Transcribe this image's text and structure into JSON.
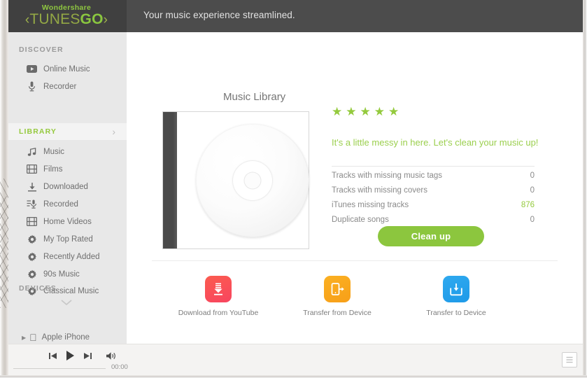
{
  "header": {
    "brand_top": "Wondershare",
    "brand_tunes": "TUNES",
    "brand_go": "GO",
    "paren_left": "‹",
    "paren_right": "›",
    "tagline": "Your music experience streamlined."
  },
  "sidebar": {
    "discover_title": "DISCOVER",
    "discover_items": [
      {
        "label": "Online Music",
        "icon": "youtube-icon"
      },
      {
        "label": "Recorder",
        "icon": "microphone-icon"
      }
    ],
    "library_title": "LIBRARY",
    "library_chevron": "›",
    "library_items": [
      {
        "label": "Music",
        "icon": "music-note-icon"
      },
      {
        "label": "Films",
        "icon": "film-icon"
      },
      {
        "label": "Downloaded",
        "icon": "download-icon"
      },
      {
        "label": "Recorded",
        "icon": "recorded-icon"
      },
      {
        "label": "Home Videos",
        "icon": "film-icon"
      },
      {
        "label": "My Top Rated",
        "icon": "gear-icon"
      },
      {
        "label": "Recently Added",
        "icon": "gear-icon"
      },
      {
        "label": "90s Music",
        "icon": "gear-icon"
      },
      {
        "label": "Classical Music",
        "icon": "gear-icon"
      }
    ],
    "expand_chevron": "⌄",
    "devices_title": "DEVICES",
    "devices_items": [
      {
        "label": "Apple iPhone",
        "icon": "apple-icon",
        "disclosure": "▶"
      }
    ]
  },
  "main": {
    "library_title": "Music Library",
    "rating_stars": 5,
    "star_glyph": "★",
    "messy_message": "It's a little messy in here. Let's clean your music up!",
    "stats": [
      {
        "label": "Tracks with missing music tags",
        "value": "0",
        "highlight": false
      },
      {
        "label": "Tracks with missing covers",
        "value": "0",
        "highlight": false
      },
      {
        "label": "iTunes missing tracks",
        "value": "876",
        "highlight": true
      },
      {
        "label": "Duplicate songs",
        "value": "0",
        "highlight": false
      }
    ],
    "cleanup_label": "Clean up",
    "actions": [
      {
        "label": "Download from YouTube",
        "icon": "download-youtube-icon",
        "color": "#f9505a"
      },
      {
        "label": "Transfer from Device",
        "icon": "transfer-from-device-icon",
        "color": "#f9a81d"
      },
      {
        "label": "Transfer to Device",
        "icon": "transfer-to-device-icon",
        "color": "#25a0ea"
      }
    ]
  },
  "player": {
    "previous": "previous-track-icon",
    "play": "play-icon",
    "next": "next-track-icon",
    "volume": "volume-icon",
    "time": "00:00",
    "playlist": "playlist-icon"
  },
  "colors": {
    "brand_green": "#8cc63e",
    "accent_green": "#94ca3d",
    "header_dark": "#4c4c4c",
    "logo_dark": "#404040",
    "sidebar_bg": "#e8e8e8"
  }
}
